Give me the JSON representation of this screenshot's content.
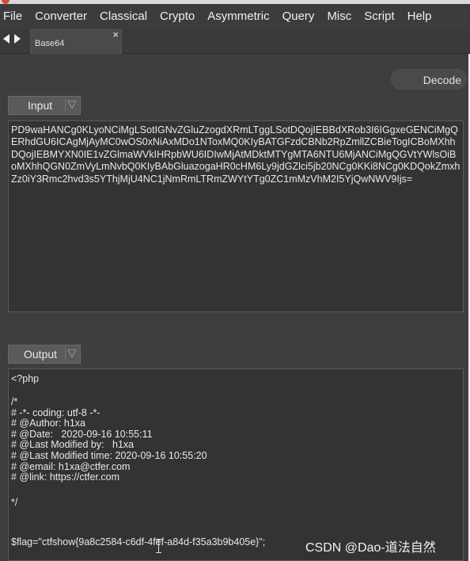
{
  "menubar": {
    "items": [
      "File",
      "Converter",
      "Classical",
      "Crypto",
      "Asymmetric",
      "Query",
      "Misc",
      "Script",
      "Help"
    ]
  },
  "tabs": [
    {
      "label": "Base64",
      "close": "×"
    }
  ],
  "toolbar": {
    "decode_label": "Decode"
  },
  "input": {
    "combo_label": "Input",
    "text": "PD9waHANCg0KLyoNCiMgLSotIGNvZGluZzogdXRmLTggLSotDQojIEBBdXRob3I6IGgxeGENCiMgQERhdGU6ICAgMjAyMC0wOS0xNiAxMDo1NToxMQ0KIyBATGFzdCBNb2RpZmllZCBieTogICBoMXhhDQojIEBMYXN0IE1vZGlmaWVkIHRpbWU6IDIwMjAtMDktMTYgMTA6NTU6MjANCiMgQGVtYWlsOiBoMXhhQGN0ZmVyLmNvbQ0KIyBAbGluazogaHR0cHM6Ly9jdGZlci5jb20NCg0KKi8NCg0KDQokZmxhZz0iY3Rmc2hvd3s5YThjMjU4NC1jNmRmLTRmZWYtYTg0ZC1mMzVhM2I5YjQwNWV9Ijs="
  },
  "output": {
    "combo_label": "Output",
    "lines": [
      "<?php",
      "",
      "/*",
      "# -*- coding: utf-8 -*-",
      "# @Author: h1xa",
      "# @Date:   2020-09-16 10:55:11",
      "# @Last Modified by:   h1xa",
      "# @Last Modified time: 2020-09-16 10:55:20",
      "# @email: h1xa@ctfer.com",
      "# @link: https://ctfer.com",
      "",
      "*/",
      "",
      "",
      "",
      "$flag=\"ctfshow{9a8c2584-c6df-4fef-a84d-f35a3b9b405e}\";"
    ]
  },
  "watermark": "CSDN @Dao-道法自然",
  "colors": {
    "background": "#3e3e3e",
    "textbox": "#333333",
    "combo": "#5a5a5a",
    "text": "#e8e8e8"
  }
}
